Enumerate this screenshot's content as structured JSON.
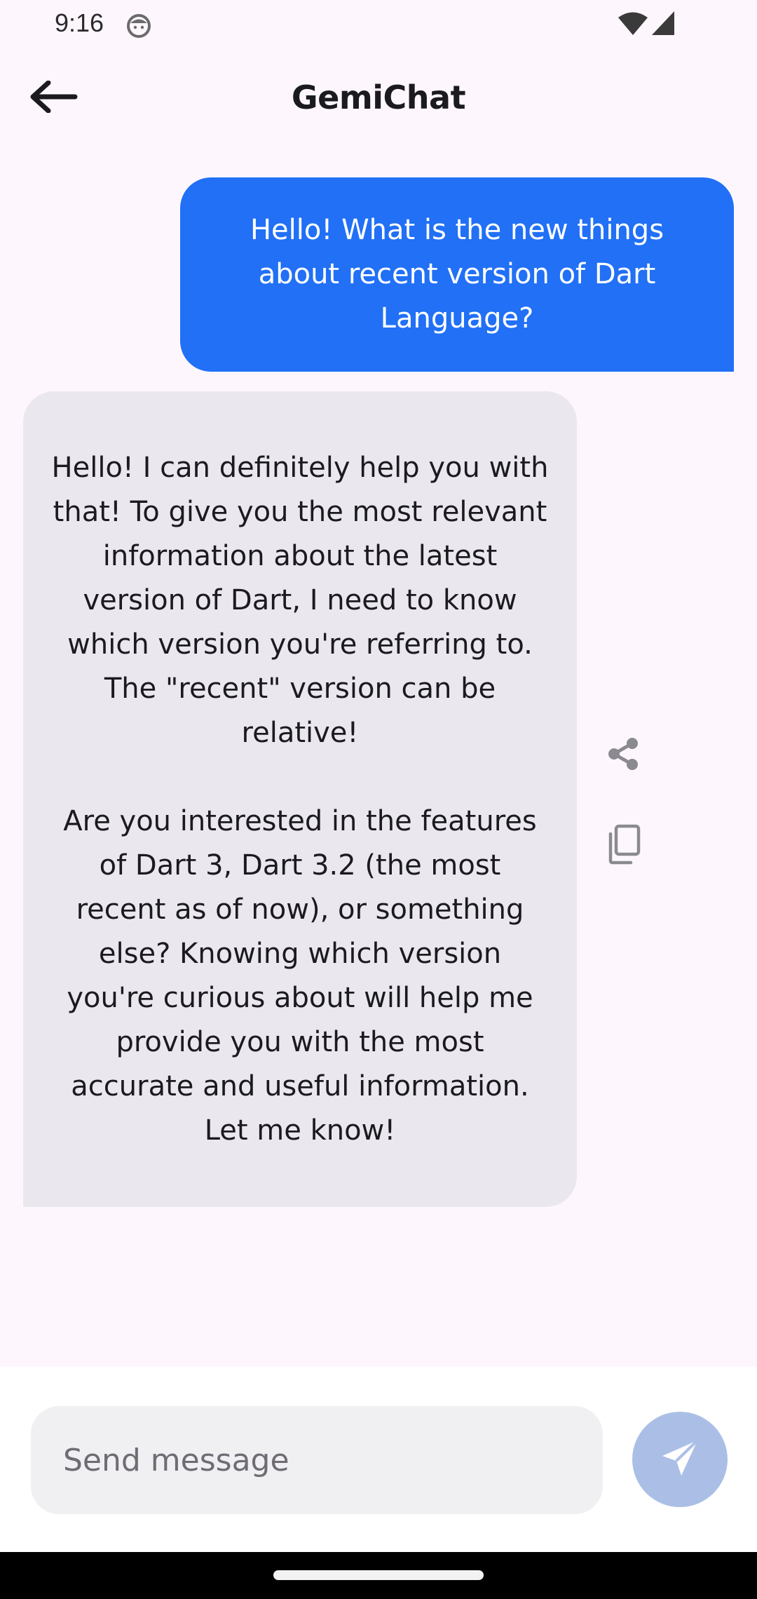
{
  "status_bar": {
    "time": "9:16",
    "app_icon": "android-face-icon",
    "wifi_icon": "wifi-icon",
    "signal_icon": "cell-signal-icon"
  },
  "app_bar": {
    "title": "GemiChat",
    "back_icon": "arrow-left-icon"
  },
  "messages": [
    {
      "role": "user",
      "text": "Hello! What is the new things about recent version of Dart Language?"
    },
    {
      "role": "model",
      "text": "Hello! I can definitely help you with that! To give you the most relevant information about the latest version of Dart, I need to know which version you're referring to. The \"recent\" version can be relative!\n\nAre you interested in the features of Dart 3, Dart 3.2 (the most recent as of now), or something else? Knowing which version you're curious about will help me provide you with the most accurate and useful information.\nLet me know!",
      "actions": [
        "share-icon",
        "copy-icon"
      ]
    }
  ],
  "composer": {
    "placeholder": "Send message",
    "value": "",
    "send_icon": "send-icon"
  },
  "colors": {
    "background": "#fdf7fd",
    "user_bubble": "#2170f6",
    "model_bubble": "#eae8ee",
    "send_button": "#abbfe6",
    "input_fill": "#f0eff2"
  }
}
